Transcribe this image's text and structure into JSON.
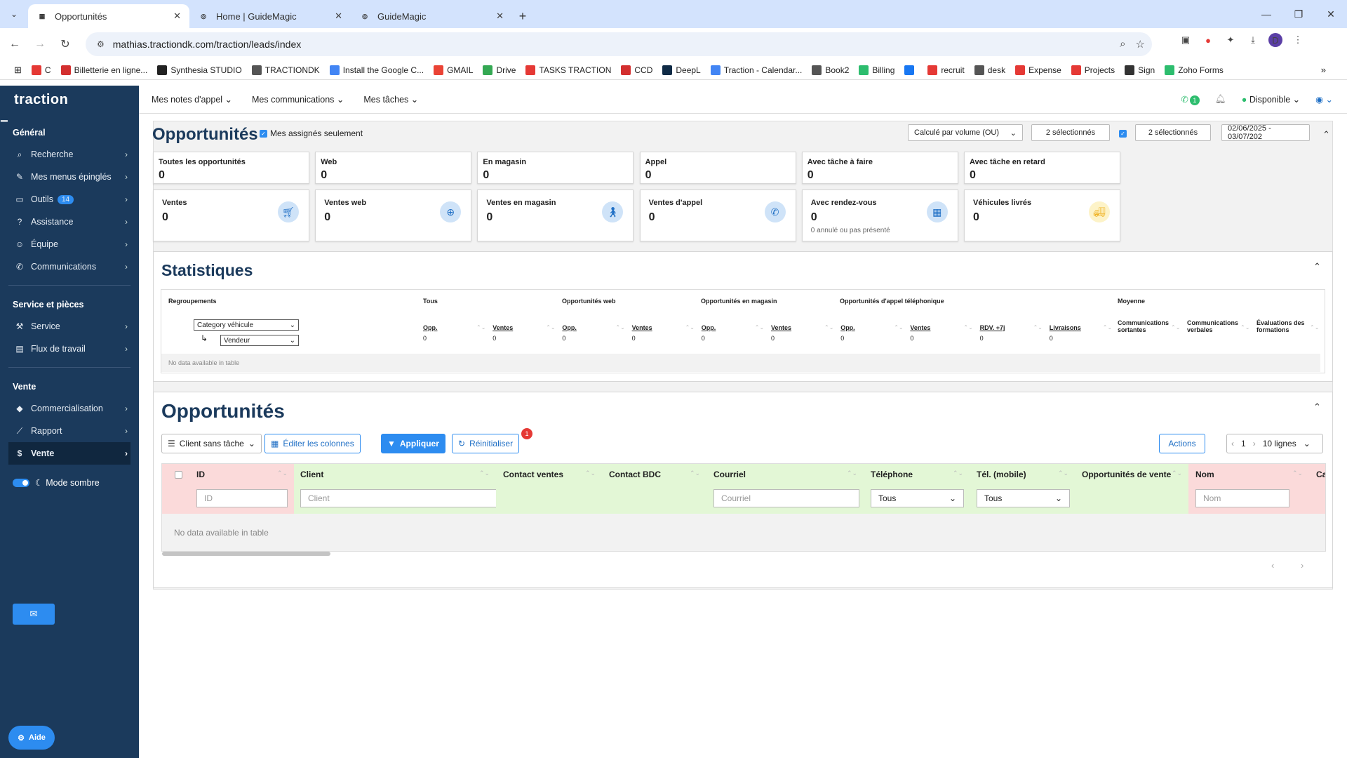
{
  "browser": {
    "tabs": [
      {
        "label": "Opportunités",
        "active": true,
        "icon": "traction-favicon"
      },
      {
        "label": "Home | GuideMagic",
        "active": false,
        "icon": "guidemagic-favicon"
      },
      {
        "label": "GuideMagic",
        "active": false,
        "icon": "guidemagic-favicon"
      }
    ],
    "url": "mathias.tractiondk.com/traction/leads/index",
    "profile_initial": "D",
    "bookmarks": [
      {
        "label": "C",
        "color": "#e53935"
      },
      {
        "label": "Billetterie en ligne...",
        "color": "#d32f2f"
      },
      {
        "label": "Synthesia STUDIO",
        "color": "#222"
      },
      {
        "label": "TRACTIONDK",
        "color": "#555"
      },
      {
        "label": "Install the Google C...",
        "color": "#4285f4"
      },
      {
        "label": "GMAIL",
        "color": "#ea4335"
      },
      {
        "label": "Drive",
        "color": "#34a853"
      },
      {
        "label": "TASKS TRACTION",
        "color": "#e53935"
      },
      {
        "label": "CCD",
        "color": "#d32f2f"
      },
      {
        "label": "DeepL",
        "color": "#0f2b46"
      },
      {
        "label": "Traction - Calendar...",
        "color": "#4285f4"
      },
      {
        "label": "Book2",
        "color": "#555"
      },
      {
        "label": "Billing",
        "color": "#2dbd6e"
      },
      {
        "label": "",
        "color": "#1877f2"
      },
      {
        "label": "recruit",
        "color": "#e53935"
      },
      {
        "label": "desk",
        "color": "#555"
      },
      {
        "label": "Expense",
        "color": "#e53935"
      },
      {
        "label": "Projects",
        "color": "#e53935"
      },
      {
        "label": "Sign",
        "color": "#333"
      },
      {
        "label": "Zoho Forms",
        "color": "#2dbd6e"
      }
    ]
  },
  "sidebar": {
    "logo": "traction",
    "sections": [
      {
        "title": "Général",
        "items": [
          {
            "label": "Recherche",
            "icon": "search-icon"
          },
          {
            "label": "Mes menus épinglés",
            "icon": "pin-icon"
          },
          {
            "label": "Outils",
            "icon": "monitor-icon",
            "badge": "14"
          },
          {
            "label": "Assistance",
            "icon": "help-icon"
          },
          {
            "label": "Équipe",
            "icon": "team-icon"
          },
          {
            "label": "Communications",
            "icon": "phone-icon"
          }
        ]
      },
      {
        "title": "Service et pièces",
        "items": [
          {
            "label": "Service",
            "icon": "wrench-icon"
          },
          {
            "label": "Flux de travail",
            "icon": "clipboard-icon"
          }
        ]
      },
      {
        "title": "Vente",
        "items": [
          {
            "label": "Commercialisation",
            "icon": "tag-icon"
          },
          {
            "label": "Rapport",
            "icon": "chart-icon"
          },
          {
            "label": "Vente",
            "icon": "dollar-icon",
            "active": true
          }
        ]
      }
    ],
    "dark_mode_label": "Mode sombre",
    "help_label": "Aide"
  },
  "topnav": {
    "items": [
      "Mes notes d'appel",
      "Mes communications",
      "Mes tâches"
    ],
    "phone_count": "1",
    "status": "Disponible"
  },
  "page": {
    "title": "Opportunités",
    "assigned_only": "Mes assignés seulement",
    "calc_select": "Calculé par volume (OU)",
    "selected1": "2 sélectionnés",
    "selected2": "2 sélectionnés",
    "date_range": "02/06/2025 - 03/07/202"
  },
  "summary_cards": [
    {
      "label": "Toutes les opportunités",
      "value": "0"
    },
    {
      "label": "Web",
      "value": "0"
    },
    {
      "label": "En magasin",
      "value": "0"
    },
    {
      "label": "Appel",
      "value": "0"
    },
    {
      "label": "Avec tâche à faire",
      "value": "0"
    },
    {
      "label": "Avec tâche en retard",
      "value": "0"
    }
  ],
  "kpi_cards": [
    {
      "label": "Ventes",
      "value": "0",
      "icon": "cart-icon",
      "sub": ""
    },
    {
      "label": "Ventes web",
      "value": "0",
      "icon": "globe-icon",
      "sub": ""
    },
    {
      "label": "Ventes en magasin",
      "value": "0",
      "icon": "walking-icon",
      "sub": ""
    },
    {
      "label": "Ventes d'appel",
      "value": "0",
      "icon": "phone-icon",
      "sub": ""
    },
    {
      "label": "Avec rendez-vous",
      "value": "0",
      "icon": "calendar-icon",
      "sub": "0 annulé ou pas présenté"
    },
    {
      "label": "Véhicules livrés",
      "value": "0",
      "icon": "truck-icon",
      "sub": ""
    }
  ],
  "stats": {
    "title": "Statistiques",
    "group_header": "Regroupements",
    "group_select1": "Category véhicule",
    "group_select2": "Vendeur",
    "headers": [
      "Tous",
      "Opportunités web",
      "Opportunités en magasin",
      "Opportunités d'appel téléphonique",
      "Moyenne"
    ],
    "subcols": [
      {
        "label": "Opp.",
        "value": "0"
      },
      {
        "label": "Ventes",
        "value": "0"
      },
      {
        "label": "Opp.",
        "value": "0"
      },
      {
        "label": "Ventes",
        "value": "0"
      },
      {
        "label": "Opp.",
        "value": "0"
      },
      {
        "label": "Ventes",
        "value": "0"
      },
      {
        "label": "Opp.",
        "value": "0"
      },
      {
        "label": "Ventes",
        "value": "0"
      },
      {
        "label": "RDV. +7j",
        "value": "0"
      },
      {
        "label": "Livraisons",
        "value": "0"
      }
    ],
    "avg_cols": [
      "Communications sortantes",
      "Communications verbales",
      "Évaluations des formations"
    ],
    "no_data": "No data available in table"
  },
  "opps": {
    "title": "Opportunités",
    "filter_select": "Client sans tâche",
    "edit_columns": "Éditer les colonnes",
    "apply": "Appliquer",
    "reset": "Réinitialiser",
    "reset_badge": "1",
    "actions": "Actions",
    "page": "1",
    "rows_select": "10 lignes",
    "columns": [
      {
        "label": "ID",
        "filter": "ID",
        "type": "input",
        "bg": "#fbdada"
      },
      {
        "label": "Client",
        "filter": "Client",
        "type": "input",
        "bg": "#e3f7d6"
      },
      {
        "label": "Contact ventes",
        "filter": "",
        "type": "none",
        "bg": "#e3f7d6"
      },
      {
        "label": "Contact BDC",
        "filter": "",
        "type": "none",
        "bg": "#e3f7d6"
      },
      {
        "label": "Courriel",
        "filter": "Courriel",
        "type": "input",
        "bg": "#e3f7d6"
      },
      {
        "label": "Téléphone",
        "filter": "Tous",
        "type": "select",
        "bg": "#e3f7d6"
      },
      {
        "label": "Tél. (mobile)",
        "filter": "Tous",
        "type": "select",
        "bg": "#e3f7d6"
      },
      {
        "label": "Opportunités de vente",
        "filter": "",
        "type": "none",
        "bg": "#e3f7d6"
      },
      {
        "label": "Nom",
        "filter": "Nom",
        "type": "input",
        "bg": "#fbdada"
      },
      {
        "label": "Carte",
        "filter": "",
        "type": "none",
        "bg": "#fbdada"
      }
    ],
    "no_data": "No data available in table"
  }
}
